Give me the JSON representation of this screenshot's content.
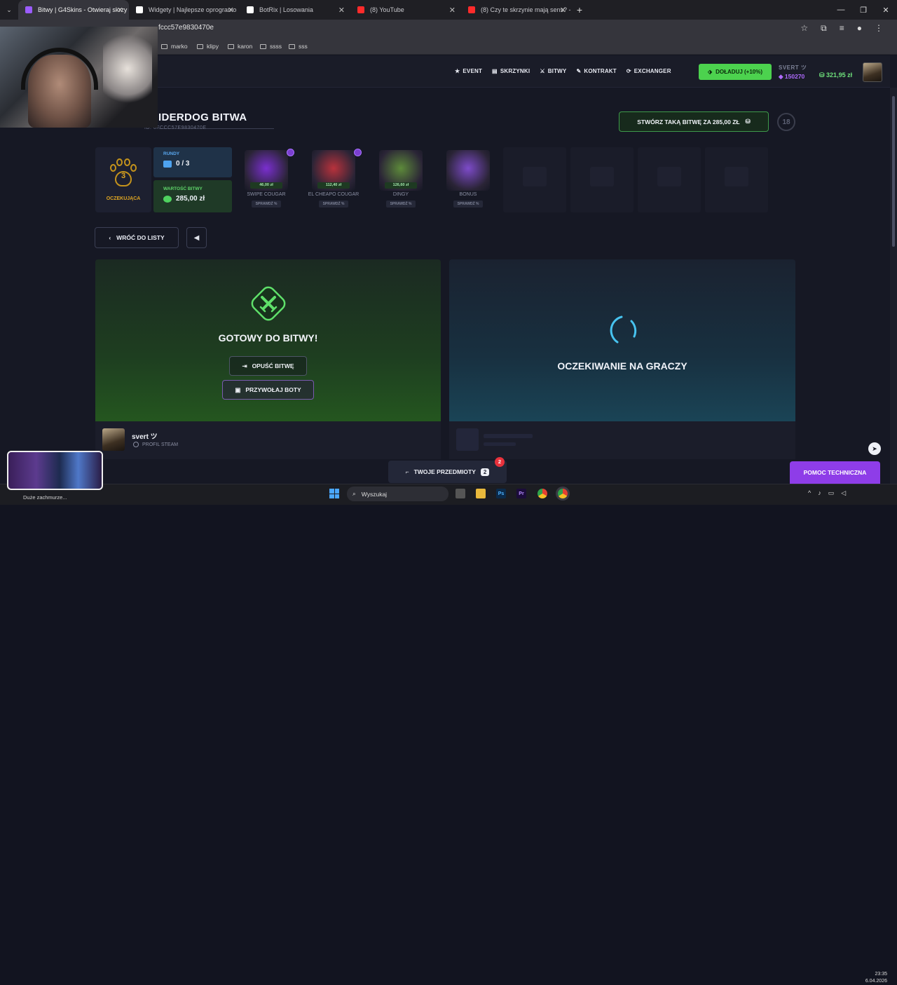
{
  "browser": {
    "tabs": [
      {
        "title": "Bitwy | G4Skins - Otwieraj skrzy",
        "color": "#9b5cff",
        "active": true
      },
      {
        "title": "Widgety | Najlepsze oprogramo",
        "color": "#ffffff",
        "active": false
      },
      {
        "title": "BotRix | Losowania",
        "color": "#ffffff",
        "active": false
      },
      {
        "title": "(8) YouTube",
        "color": "#ff2b2b",
        "active": false
      },
      {
        "title": "(8) Czy te skrzynie mają sens? -",
        "color": "#ff2b2b",
        "active": false
      }
    ],
    "url": "fccc57e9830470e",
    "bookmarks": [
      "marko",
      "klipy",
      "karon",
      "ssss",
      "sss"
    ]
  },
  "nav": {
    "links": [
      {
        "label": "EVENT",
        "icon": "star-icon"
      },
      {
        "label": "SKRZYNKI",
        "icon": "case-icon"
      },
      {
        "label": "BITWY",
        "icon": "battle-icon"
      },
      {
        "label": "KONTRAKT",
        "icon": "pen-icon"
      },
      {
        "label": "EXCHANGER",
        "icon": "exchange-icon"
      }
    ],
    "deposit_label": "DOŁADUJ (+10%)",
    "username": "SVERT ツ",
    "coins": "150270",
    "balance": "321,95 zł"
  },
  "battle": {
    "title": "IDERDOG BITWA",
    "id": "ID: 6FCCC57E9830470E",
    "create_label": "STWÓRZ TAKĄ BITWĘ ZA 285,00 ZŁ",
    "age_badge": "18",
    "players_count": "3",
    "status_label": "OCZEKUJĄCA",
    "rounds_label": "RUNDY",
    "rounds_value": "0 / 3",
    "value_label": "WARTOŚĆ BITWY",
    "value_amount": "285,00 zł",
    "cases": [
      {
        "name": "SWIPE COUGAR",
        "price": "46,00 zł",
        "check": "SPRAWDŹ %",
        "color": "#7a2fcf"
      },
      {
        "name": "EL CHEAPO COUGAR",
        "price": "112,40 zł",
        "check": "SPRAWDŹ %",
        "color": "#b8323c"
      },
      {
        "name": "DINGY",
        "price": "126,60 zł",
        "check": "SPRAWDŹ %",
        "color": "#5d8a3a"
      },
      {
        "name": "BONUS",
        "price": "",
        "check": "SPRAWDŹ %",
        "color": "#7d4bc9"
      }
    ],
    "back_label": "WRÓĆ DO LISTY",
    "ready_text": "GOTOWY DO BITWY!",
    "leave_label": "OPUŚĆ BITWĘ",
    "bots_label": "PRZYWOŁAJ BOTY",
    "waiting_text": "OCZEKIWANIE NA GRACZY",
    "player_name": "svert ツ",
    "player_link": "PROFIL STEAM"
  },
  "footer": {
    "items_label": "TWOJE PRZEDMIOTY",
    "items_count": "2",
    "notif_count": "2",
    "help_label": "POMOC TECHNICZNA"
  },
  "taskbar": {
    "weather": "Duże zachmurze...",
    "search_placeholder": "Wyszukaj",
    "time": "23:35",
    "date": "6.04.2026"
  }
}
